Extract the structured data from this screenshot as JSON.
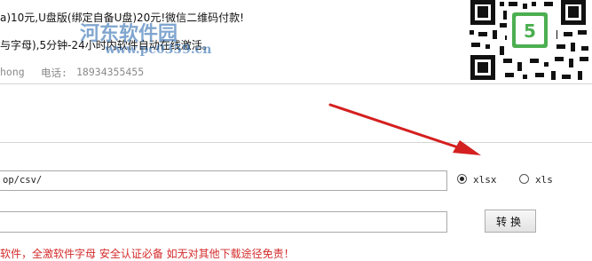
{
  "header": {
    "price_line": "a)10元,U盘版(绑定自备U盘)20元!微信二维码付款!",
    "activation_line": "与字母),5分钟-24小时内软件自动在线激活。",
    "contact_name": "hong",
    "phone_label": "电话:",
    "phone_number": "18934355455"
  },
  "watermark": {
    "site_name": "河东软件园",
    "url": "www.pc0359.cn"
  },
  "form": {
    "input_path_value": "op/csv/",
    "output_path_value": "",
    "format_options": [
      {
        "label": "xlsx",
        "selected": true
      },
      {
        "label": "xls",
        "selected": false
      }
    ],
    "convert_button_label": "转换"
  },
  "footer": {
    "warning_text": "软件，全激软件字母 安全认证必备 如无对其他下载途径免责！"
  },
  "colors": {
    "arrow": "#d42020",
    "warning": "#d42b2b"
  }
}
